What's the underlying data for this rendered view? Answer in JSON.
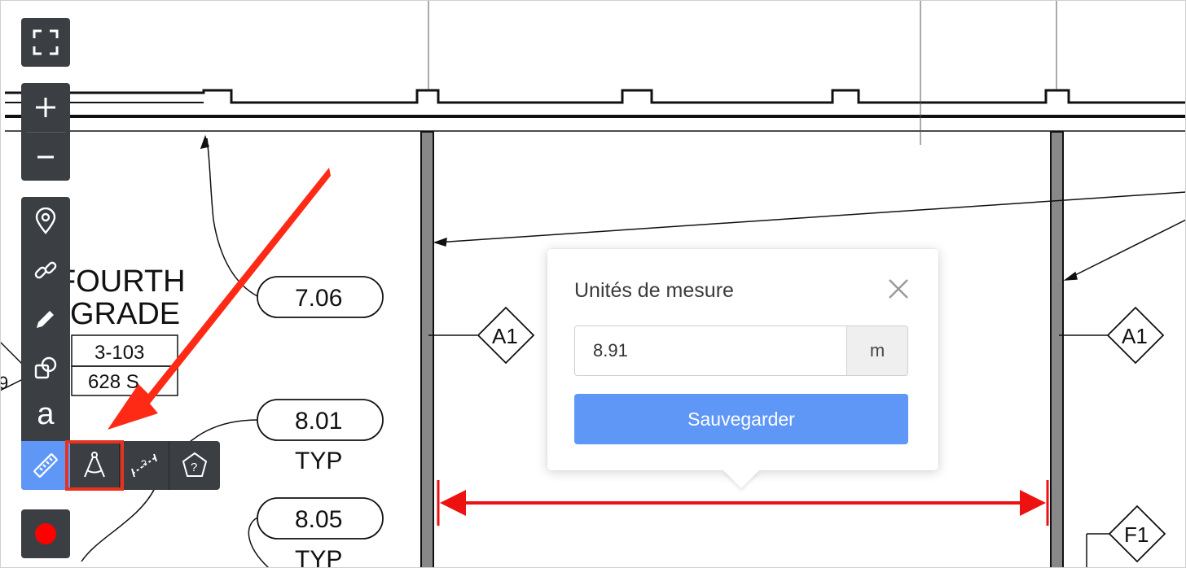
{
  "drawing": {
    "room_name_line1": "FOURTH",
    "room_name_line2": "GRADE",
    "room_number": "3-103",
    "room_area": "628 S",
    "left_edge_text": "9",
    "tag_7_06": "7.06",
    "tag_8_01": "8.01",
    "tag_8_01_note": "TYP",
    "tag_8_05": "8.05",
    "tag_8_05_note": "TYP",
    "marker_a1_left": "A1",
    "marker_a1_right": "A1",
    "marker_f1": "F1"
  },
  "toolbar": {
    "fullscreen_icon": "fullscreen-icon",
    "zoom_in_icon": "plus-icon",
    "zoom_out_icon": "minus-icon",
    "tools": [
      "map-pin-icon",
      "link-icon",
      "pencil-icon",
      "shapes-icon",
      "text-icon",
      "ruler-icon"
    ],
    "text_tool_label": "a",
    "record_icon": "record-icon",
    "record_color": "#ff0000",
    "active_color": "#5f97f7"
  },
  "measure_submenu": {
    "items": [
      "compass-icon",
      "distance-icon",
      "area-icon"
    ],
    "area_label": "?"
  },
  "popup": {
    "title": "Unités de mesure",
    "value": "8.91",
    "unit": "m",
    "save_label": "Sauvegarder"
  },
  "annotation": {
    "arrow_color": "#ff2a16",
    "measure_color": "#ee1111"
  }
}
